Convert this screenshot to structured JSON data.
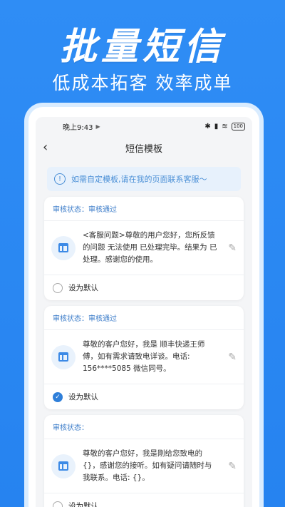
{
  "promo": {
    "title": "批量短信",
    "subtitle": "低成本拓客  效率成单"
  },
  "status_bar": {
    "time": "晚上9:43",
    "battery": "100"
  },
  "nav": {
    "title": "短信模板",
    "back_icon": "chevron-left-icon"
  },
  "notice": {
    "text": "如需自定模板,请在我的页面联系客服～"
  },
  "templates": [
    {
      "status": "审核状态：审核通过",
      "content": "<客服问题>尊敬的用户您好，您所反馈的问题 无法使用 已处理完毕。结果为 已处理。感谢您的使用。",
      "default_label": "设为默认",
      "is_default": false
    },
    {
      "status": "审核状态：审核通过",
      "content": "尊敬的客户您好，我是 顺丰快递王师傅，如有需求请致电详谈。电话: 156****5085 微信同号。",
      "default_label": "设为默认",
      "is_default": true
    },
    {
      "status": "审核状态：",
      "content": "尊敬的客户您好，我是刚给您致电的{}，感谢您的接听。如有疑问请随时与我联系。电话: {}。",
      "default_label": "设为默认",
      "is_default": false
    }
  ],
  "colors": {
    "background": "#2683f0",
    "accent": "#2f7fd9",
    "notice_bg": "#e7f1fc"
  }
}
